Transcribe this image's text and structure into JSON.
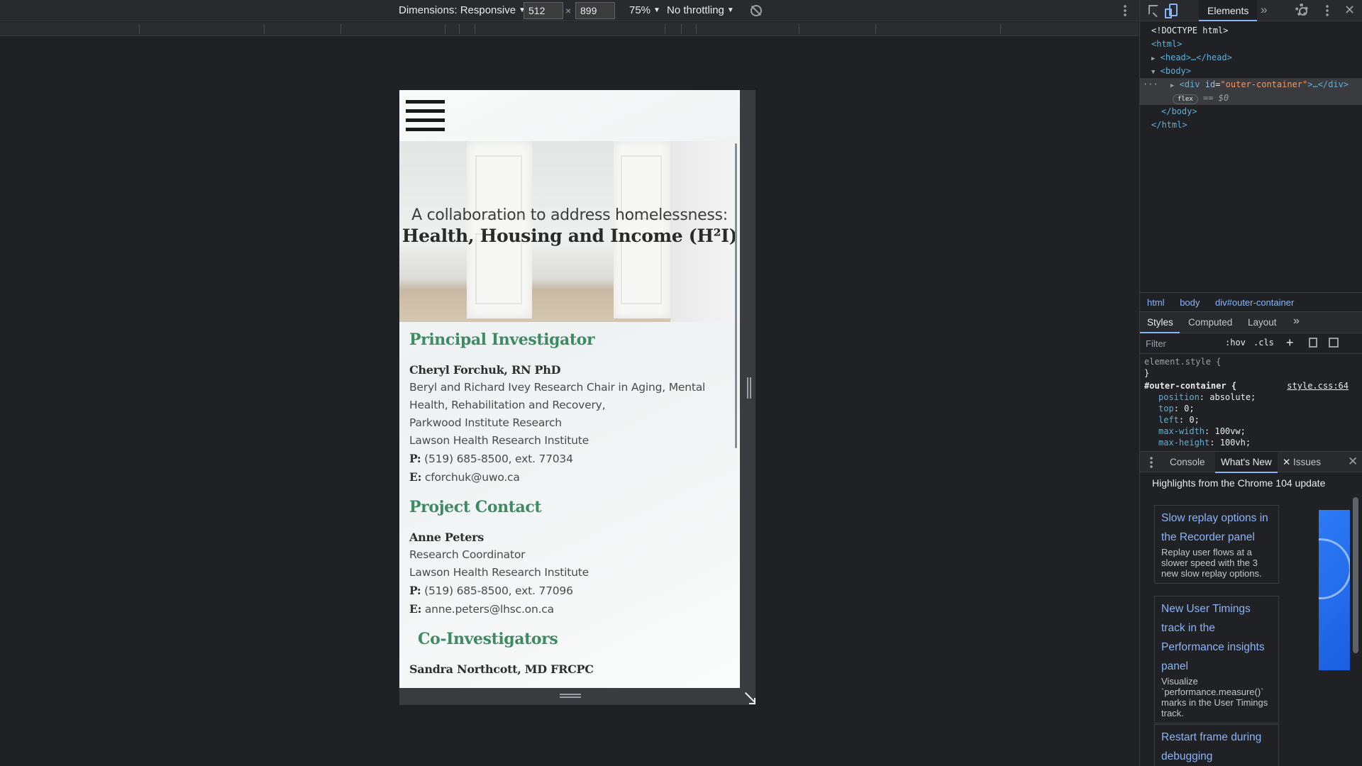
{
  "device_toolbar": {
    "dimensions_label": "Dimensions: Responsive",
    "width_value": "512",
    "times": "×",
    "height_value": "899",
    "zoom": "75%",
    "throttling": "No throttling"
  },
  "page": {
    "hero_subtitle": "A collaboration to address homelessness:",
    "hero_title": "Health, Housing and Income (H²I)",
    "sections": {
      "principal": {
        "heading": "Principal Investigator",
        "name": "Cheryl Forchuk, RN PhD",
        "lines": [
          "Beryl and Richard Ivey Research Chair in Aging, Mental",
          "Health, Rehabilitation and Recovery,",
          "Parkwood Institute Research",
          "Lawson Health Research Institute"
        ],
        "phone_label": "P:",
        "phone": "(519) 685-8500, ext. 77034",
        "email_label": "E:",
        "email": "cforchuk@uwo.ca"
      },
      "contact": {
        "heading": "Project Contact",
        "name": "Anne Peters",
        "lines": [
          "Research Coordinator",
          "Lawson Health Research Institute"
        ],
        "phone_label": "P:",
        "phone": "(519) 685-8500, ext. 77096",
        "email_label": "E:",
        "email": "anne.peters@lhsc.on.ca"
      },
      "coinvestigators": {
        "heading": "Co-Investigators",
        "first_name": "Sandra Northcott, MD FRCPC"
      }
    }
  },
  "devtools": {
    "tab_elements": "Elements",
    "dom": {
      "doctype": "<!DOCTYPE html>",
      "html_open": "<html>",
      "head": "<head>…</head>",
      "body_open": "<body>",
      "div_tag": "div",
      "div_attr_name": "id",
      "div_attr_value": "\"outer-container\"",
      "div_tail": ">…</div>",
      "flex_badge": "flex",
      "selected_marker": "== $0",
      "body_close": "</body>",
      "html_close": "</html>",
      "dots": "···"
    },
    "breadcrumbs": [
      "html",
      "body",
      "div#outer-container"
    ],
    "styles_tabs": [
      "Styles",
      "Computed",
      "Layout"
    ],
    "filter_placeholder": "Filter",
    "hov": ":hov",
    "cls": ".cls",
    "styles": {
      "element_style": "element.style {",
      "close_brace": "}",
      "rule_selector": "#outer-container {",
      "rule_source": "style.css:64",
      "props": [
        {
          "name": "position",
          "value": "absolute;"
        },
        {
          "name": "top",
          "value": "0;"
        },
        {
          "name": "left",
          "value": "0;"
        },
        {
          "name": "max-width",
          "value": "100vw;"
        },
        {
          "name": "max-height",
          "value": "100vh;"
        }
      ]
    },
    "drawer_tabs": [
      "Console",
      "What's New",
      "Issues"
    ],
    "whats_new": {
      "heading": "Highlights from the Chrome 104 update",
      "cards": [
        {
          "title": "Slow replay options in the Recorder panel",
          "desc": "Replay user flows at a slower speed with the 3 new slow replay options."
        },
        {
          "title": "New User Timings track in the Performance insights panel",
          "desc": "Visualize `performance.measure()` marks in the User Timings track."
        },
        {
          "title": "Restart frame during debugging",
          "desc": ""
        }
      ]
    }
  }
}
